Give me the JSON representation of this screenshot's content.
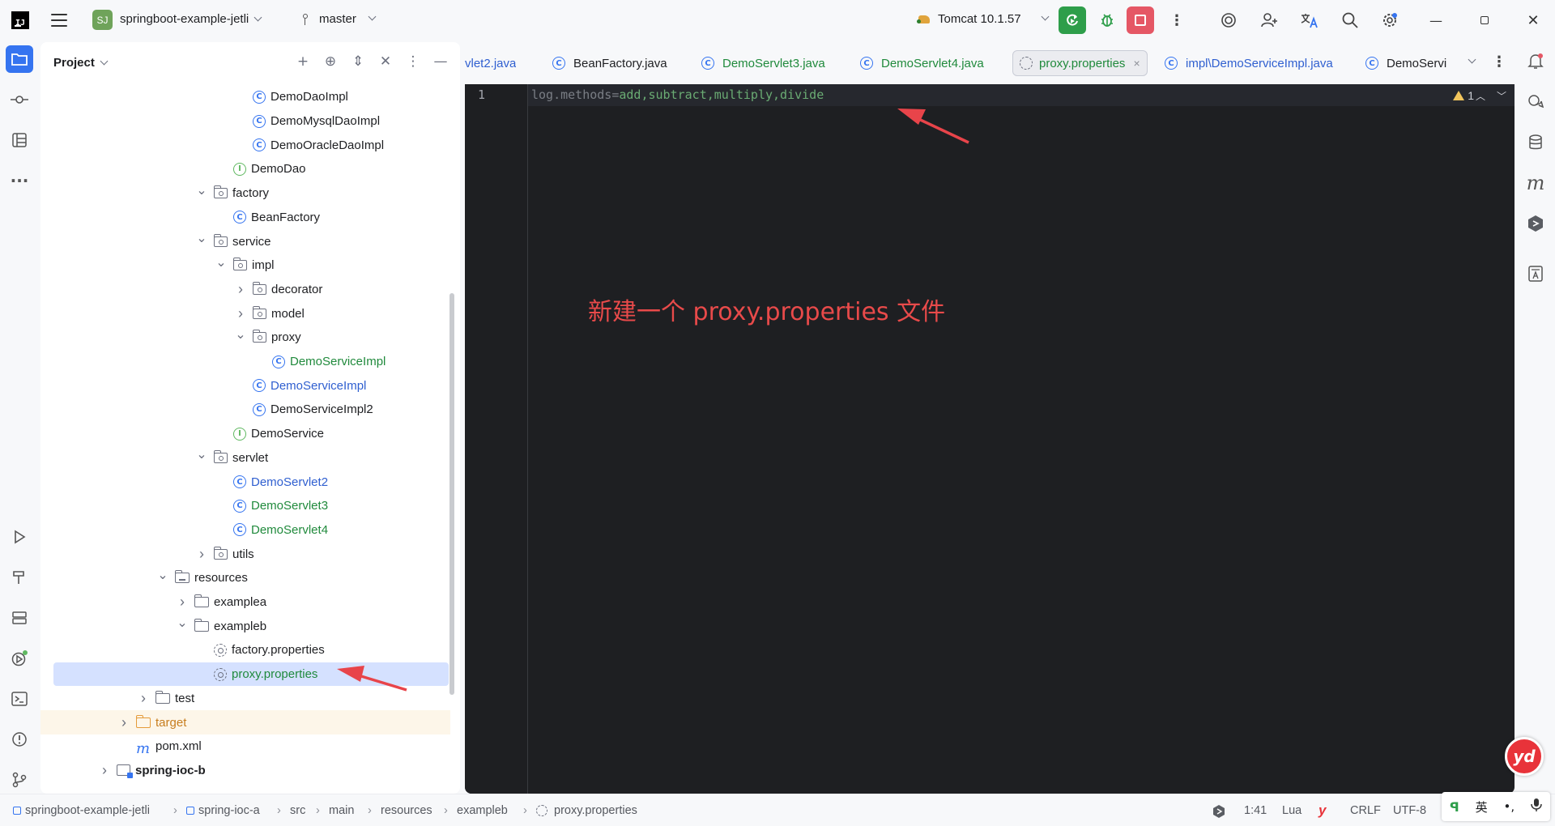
{
  "titlebar": {
    "project_badge": "SJ",
    "project_name": "springboot-example-jetli",
    "branch": "master",
    "run_config": "Tomcat 10.1.57"
  },
  "project_panel": {
    "title": "Project",
    "tree": [
      {
        "label": "DemoDaoImpl",
        "icon": "class-icon",
        "indent": 6,
        "arrow": "",
        "color": "default"
      },
      {
        "label": "DemoMysqlDaoImpl",
        "icon": "class-icon",
        "indent": 6,
        "arrow": "",
        "color": "default"
      },
      {
        "label": "DemoOracleDaoImpl",
        "icon": "class-icon",
        "indent": 6,
        "arrow": "",
        "color": "default"
      },
      {
        "label": "DemoDao",
        "icon": "interface-icon",
        "indent": 5,
        "arrow": "",
        "color": "default"
      },
      {
        "label": "factory",
        "icon": "package-icon",
        "indent": 4,
        "arrow": "expanded",
        "color": "default"
      },
      {
        "label": "BeanFactory",
        "icon": "class-icon",
        "indent": 5,
        "arrow": "",
        "color": "default"
      },
      {
        "label": "service",
        "icon": "package-icon",
        "indent": 4,
        "arrow": "expanded",
        "color": "default"
      },
      {
        "label": "impl",
        "icon": "package-icon",
        "indent": 5,
        "arrow": "expanded",
        "color": "default"
      },
      {
        "label": "decorator",
        "icon": "package-icon",
        "indent": 6,
        "arrow": "collapsed",
        "color": "default"
      },
      {
        "label": "model",
        "icon": "package-icon",
        "indent": 6,
        "arrow": "collapsed",
        "color": "default"
      },
      {
        "label": "proxy",
        "icon": "package-icon",
        "indent": 6,
        "arrow": "expanded",
        "color": "default"
      },
      {
        "label": "DemoServiceImpl",
        "icon": "class-icon",
        "indent": 7,
        "arrow": "",
        "color": "green"
      },
      {
        "label": "DemoServiceImpl",
        "icon": "class-icon",
        "indent": 6,
        "arrow": "",
        "color": "blue"
      },
      {
        "label": "DemoServiceImpl2",
        "icon": "class-icon",
        "indent": 6,
        "arrow": "",
        "color": "default"
      },
      {
        "label": "DemoService",
        "icon": "interface-icon",
        "indent": 5,
        "arrow": "",
        "color": "default"
      },
      {
        "label": "servlet",
        "icon": "package-icon",
        "indent": 4,
        "arrow": "expanded",
        "color": "default"
      },
      {
        "label": "DemoServlet2",
        "icon": "class-icon",
        "indent": 5,
        "arrow": "",
        "color": "blue"
      },
      {
        "label": "DemoServlet3",
        "icon": "class-icon",
        "indent": 5,
        "arrow": "",
        "color": "green"
      },
      {
        "label": "DemoServlet4",
        "icon": "class-icon",
        "indent": 5,
        "arrow": "",
        "color": "green"
      },
      {
        "label": "utils",
        "icon": "package-icon",
        "indent": 4,
        "arrow": "collapsed",
        "color": "default"
      },
      {
        "label": "resources",
        "icon": "resources-folder-icon",
        "indent": 2,
        "arrow": "expanded",
        "color": "default"
      },
      {
        "label": "examplea",
        "icon": "folder-icon",
        "indent": 3,
        "arrow": "collapsed",
        "color": "default"
      },
      {
        "label": "exampleb",
        "icon": "folder-icon",
        "indent": 3,
        "arrow": "expanded",
        "color": "default"
      },
      {
        "label": "factory.properties",
        "icon": "properties-icon",
        "indent": 4,
        "arrow": "",
        "color": "default"
      },
      {
        "label": "proxy.properties",
        "icon": "properties-icon",
        "indent": 4,
        "arrow": "",
        "color": "green",
        "selected": true
      },
      {
        "label": "test",
        "icon": "folder-icon",
        "indent": 1,
        "arrow": "collapsed",
        "color": "default"
      },
      {
        "label": "target",
        "icon": "excluded-folder-icon",
        "indent": 0,
        "arrow": "collapsed",
        "color": "orange",
        "highlight": true
      },
      {
        "label": "pom.xml",
        "icon": "maven-icon",
        "indent": 0,
        "arrow": "",
        "color": "default"
      },
      {
        "label": "spring-ioc-b",
        "icon": "module-icon",
        "indent": -1,
        "arrow": "collapsed",
        "color": "bold"
      }
    ]
  },
  "editor": {
    "tabs": [
      {
        "label": "vlet2.java",
        "icon": "class-icon",
        "color": "blue",
        "active": false
      },
      {
        "label": "BeanFactory.java",
        "icon": "class-icon",
        "color": "default",
        "active": false
      },
      {
        "label": "DemoServlet3.java",
        "icon": "class-icon",
        "color": "green",
        "active": false
      },
      {
        "label": "DemoServlet4.java",
        "icon": "class-icon",
        "color": "green",
        "active": false
      },
      {
        "label": "proxy.properties",
        "icon": "properties-icon",
        "color": "green",
        "active": true
      },
      {
        "label": "impl\\DemoServiceImpl.java",
        "icon": "class-icon",
        "color": "blue",
        "active": false
      },
      {
        "label": "DemoServi",
        "icon": "class-icon",
        "color": "default",
        "active": false
      }
    ],
    "line_number": "1",
    "code_key": "log.methods",
    "code_eq": "=",
    "code_value": "add,subtract,multiply,divide",
    "warning_count": "1",
    "annotation": "新建一个 proxy.properties 文件"
  },
  "statusbar": {
    "breadcrumbs": [
      "springboot-example-jetli",
      "spring-ioc-a",
      "src",
      "main",
      "resources",
      "exampleb",
      "proxy.properties"
    ],
    "position": "1:41",
    "language": "Lua",
    "line_separator": "CRLF",
    "encoding": "UTF-8",
    "ime_lang": "英",
    "ime_punct": "•,"
  },
  "floating": {
    "yd_badge": "yd"
  },
  "colors": {
    "accent": "#3574f0",
    "selected_row": "#d5e1ff",
    "run_green": "#2e9e4a",
    "stop_red": "#e55765",
    "annotation_red": "#e84a4a",
    "editor_bg": "#1e1f22"
  }
}
